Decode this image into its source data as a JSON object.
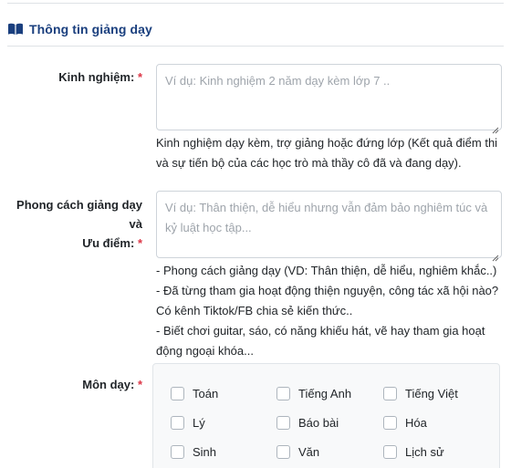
{
  "section": {
    "title": "Thông tin giảng dạy",
    "icon": "book-open-icon",
    "accent_color": "#1a3f7e"
  },
  "fields": {
    "experience": {
      "label": "Kinh nghiệm:",
      "required_mark": "*",
      "placeholder": "Ví dụ: Kinh nghiệm 2 năm dạy kèm lớp 7 ..",
      "value": "",
      "help": "Kinh nghiệm dạy kèm, trợ giảng hoặc đứng lớp (Kết quả điểm thi và sự tiến bộ của các học trò mà thầy cô đã và đang dạy)."
    },
    "style": {
      "label_line1": "Phong cách giảng dạy và",
      "label_line2": "Ưu điểm:",
      "required_mark": "*",
      "placeholder": "Ví dụ: Thân thiện, dễ hiểu nhưng vẫn đảm bảo nghiêm túc và kỷ luật học tập...",
      "value": "",
      "help": [
        "- Phong cách giảng dạy (VD: Thân thiện, dễ hiểu, nghiêm khắc..)",
        "- Đã từng tham gia hoạt động thiện nguyện, công tác xã hội nào? Có kênh Tiktok/FB chia sẻ kiến thức..",
        "- Biết chơi guitar, sáo, có năng khiếu hát, vẽ hay tham gia hoạt động ngoại khóa..."
      ]
    },
    "subjects": {
      "label": "Môn dạy:",
      "required_mark": "*",
      "options": [
        {
          "label": "Toán",
          "checked": false
        },
        {
          "label": "Tiếng Anh",
          "checked": false
        },
        {
          "label": "Tiếng Việt",
          "checked": false
        },
        {
          "label": "Lý",
          "checked": false
        },
        {
          "label": "Báo bài",
          "checked": false
        },
        {
          "label": "Hóa",
          "checked": false
        },
        {
          "label": "Sinh",
          "checked": false
        },
        {
          "label": "Văn",
          "checked": false
        },
        {
          "label": "Lịch sử",
          "checked": false
        }
      ]
    }
  },
  "colors": {
    "required": "#dc3545",
    "border": "#ced4da",
    "placeholder": "#9ea4ab"
  }
}
